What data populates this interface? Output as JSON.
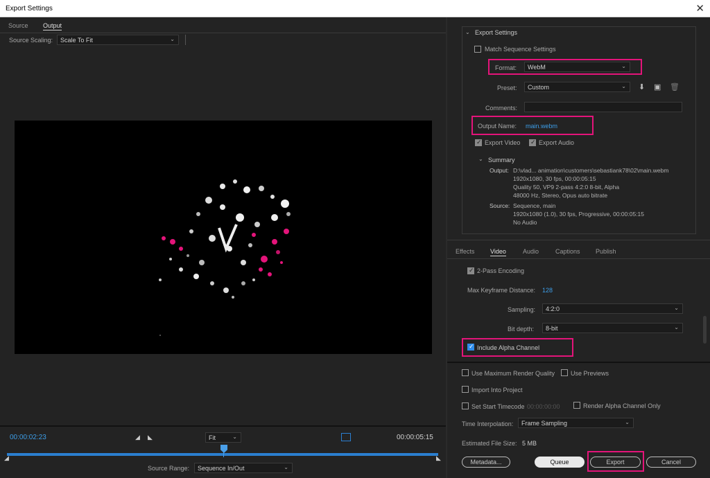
{
  "window": {
    "title": "Export Settings",
    "close": "✕"
  },
  "left": {
    "tabs": [
      {
        "label": "Source"
      },
      {
        "label": "Output"
      }
    ],
    "source_scaling": {
      "label": "Source Scaling:",
      "value": "Scale To Fit"
    },
    "timeline": {
      "current_time": "00:00:02:23",
      "end_time": "00:00:05:15",
      "zoom": "Fit",
      "playhead_fraction": 0.51,
      "source_range_label": "Source Range:",
      "source_range_value": "Sequence In/Out"
    }
  },
  "export_settings": {
    "section_title": "Export Settings",
    "match_sequence": "Match Sequence Settings",
    "format_label": "Format:",
    "format_value": "WebM",
    "preset_label": "Preset:",
    "preset_value": "Custom",
    "comments_label": "Comments:",
    "comments_value": "",
    "output_name_label": "Output Name:",
    "output_name_value": "main.webm",
    "export_video": "Export Video",
    "export_audio": "Export Audio",
    "summary": {
      "title": "Summary",
      "output_label": "Output:",
      "output_lines": [
        "D:\\vlad... animation\\customers\\sebastiank78\\02\\main.webm",
        "1920x1080, 30 fps, 00:00:05:15",
        "Quality 50, VP9 2-pass 4:2:0 8-bit, Alpha",
        "48000 Hz, Stereo, Opus auto bitrate"
      ],
      "source_label": "Source:",
      "source_lines": [
        "Sequence, main",
        "1920x1080 (1.0), 30 fps, Progressive, 00:00:05:15",
        "No Audio"
      ]
    }
  },
  "settings_tabs": [
    {
      "label": "Effects"
    },
    {
      "label": "Video"
    },
    {
      "label": "Audio"
    },
    {
      "label": "Captions"
    },
    {
      "label": "Publish"
    }
  ],
  "video": {
    "two_pass": "2-Pass Encoding",
    "max_keyframe_label": "Max Keyframe Distance:",
    "max_keyframe_value": "128",
    "sampling_label": "Sampling:",
    "sampling_value": "4:2:0",
    "bit_depth_label": "Bit depth:",
    "bit_depth_value": "8-bit",
    "include_alpha": "Include Alpha Channel"
  },
  "bottom": {
    "max_render_quality": "Use Maximum Render Quality",
    "use_previews": "Use Previews",
    "import_into_project": "Import Into Project",
    "set_start_timecode": "Set Start Timecode",
    "start_timecode_value": "00:00:00:00",
    "render_alpha_only": "Render Alpha Channel Only",
    "time_interpolation_label": "Time Interpolation:",
    "time_interpolation_value": "Frame Sampling",
    "estimated_size_label": "Estimated File Size:",
    "estimated_size_value": "5 MB",
    "metadata_button": "Metadata...",
    "queue_button": "Queue",
    "export_button": "Export",
    "cancel_button": "Cancel"
  },
  "colors": {
    "highlight": "#e4147a",
    "accent_blue": "#2d8ceb",
    "timeline_blue": "#2b7fd0"
  },
  "icons": [
    "close-icon",
    "chevron-down-icon",
    "import-preset-icon",
    "save-preset-icon",
    "delete-preset-icon",
    "mark-in-icon",
    "mark-out-icon",
    "playhead-icon",
    "aspect-icon"
  ]
}
